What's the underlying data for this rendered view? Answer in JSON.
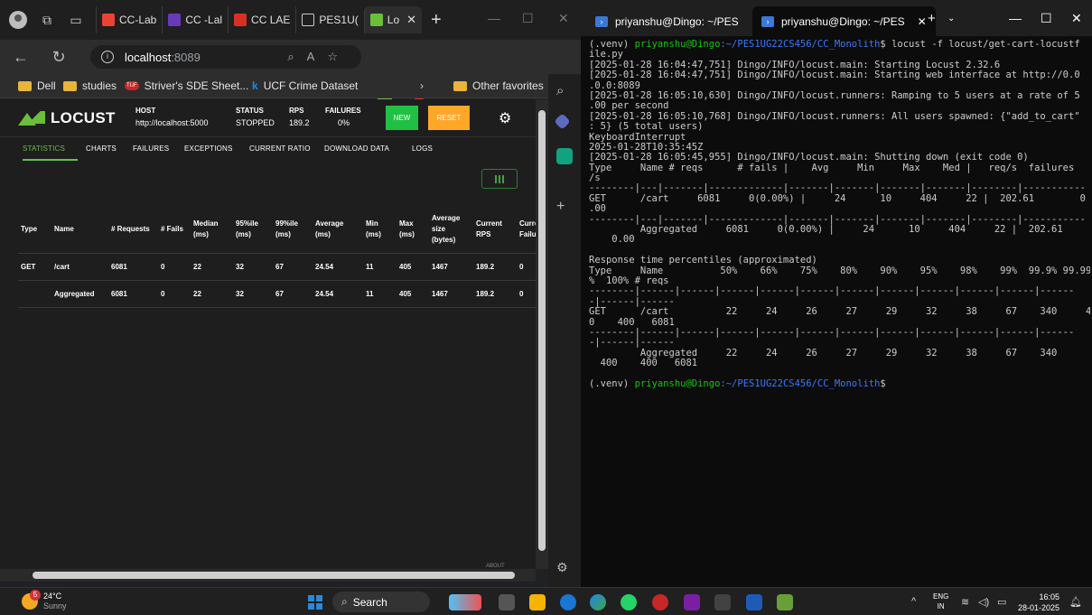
{
  "browser": {
    "tabs": [
      {
        "label": "CC-Lab",
        "icon": "gmail-icon",
        "color": "#ea4335"
      },
      {
        "label": "CC -Lal",
        "icon": "forms-icon",
        "color": "#673ab7"
      },
      {
        "label": "CC LAE",
        "icon": "docs-icon",
        "color": "#d93025"
      },
      {
        "label": "PES1U(",
        "icon": "document-icon",
        "color": "#9e9e9e"
      },
      {
        "label": "Lo",
        "icon": "locust-icon",
        "color": "#6abf3a"
      }
    ],
    "url_host": "localhost",
    "url_port": ":8089",
    "bookmarks": [
      "Dell",
      "studies",
      "Striver's SDE Sheet...",
      "UCF Crime Dataset",
      "Other favorites"
    ]
  },
  "locust": {
    "brand": "LOCUST",
    "host_label": "HOST",
    "host_value": "http://localhost:5000",
    "status_label": "STATUS",
    "status_value": "STOPPED",
    "rps_label": "RPS",
    "rps_value": "189.2",
    "failures_label": "FAILURES",
    "failures_value": "0%",
    "new_label": "NEW",
    "reset_label": "RESET",
    "tabs": [
      "STATISTICS",
      "CHARTS",
      "FAILURES",
      "EXCEPTIONS",
      "CURRENT RATIO",
      "DOWNLOAD DATA",
      "LOGS"
    ],
    "columns": [
      "Type",
      "Name",
      "# Requests",
      "# Fails",
      "Median (ms)",
      "95%ile (ms)",
      "99%ile (ms)",
      "Average (ms)",
      "Min (ms)",
      "Max (ms)",
      "Average size (bytes)",
      "Current RPS",
      "Curre Failu"
    ],
    "rows": [
      [
        "GET",
        "/cart",
        "6081",
        "0",
        "22",
        "32",
        "67",
        "24.54",
        "11",
        "405",
        "1467",
        "189.2",
        "0"
      ],
      [
        "",
        "Aggregated",
        "6081",
        "0",
        "22",
        "32",
        "67",
        "24.54",
        "11",
        "405",
        "1467",
        "189.2",
        "0"
      ]
    ],
    "about_fragment": "ABOUT"
  },
  "terminal": {
    "tabs": [
      "priyanshu@Dingo: ~/PES",
      "priyanshu@Dingo: ~/PES"
    ],
    "prompt_env": "(.venv) ",
    "prompt_user": "priyanshu@Dingo",
    "prompt_path": ":~/PES1UG22CS456/CC_Monolith",
    "command": "$ locust -f locust/get-cart-locustf",
    "lines": [
      "ile.py",
      "[2025-01-28 16:04:47,751] Dingo/INFO/locust.main: Starting Locust 2.32.6",
      "[2025-01-28 16:04:47,751] Dingo/INFO/locust.main: Starting web interface at http://0.0",
      ".0.0:8089",
      "[2025-01-28 16:05:10,630] Dingo/INFO/locust.runners: Ramping to 5 users at a rate of 5",
      ".00 per second",
      "[2025-01-28 16:05:10,768] Dingo/INFO/locust.runners: All users spawned: {\"add_to_cart\"",
      ": 5} (5 total users)",
      "KeyboardInterrupt",
      "2025-01-28T10:35:45Z",
      "[2025-01-28 16:05:45,955] Dingo/INFO/locust.main: Shutting down (exit code 0)",
      "Type     Name # reqs      # fails |    Avg     Min     Max    Med |   req/s  failures",
      "/s",
      "--------|---|-------|-------------|-------|-------|-------|-------|--------|-----------",
      "GET      /cart     6081     0(0.00%) |     24      10     404     22 |  202.61        0",
      ".00",
      "--------|---|-------|-------------|-------|-------|-------|-------|--------|-----------",
      "         Aggregated     6081     0(0.00%) |     24      10     404     22 |  202.61",
      "    0.00",
      "",
      "Response time percentiles (approximated)",
      "Type     Name          50%    66%    75%    80%    90%    95%    98%    99%  99.9% 99.99",
      "%  100% # reqs",
      "--------|------|------|------|------|------|------|------|------|------|------|------",
      "-|------|------",
      "GET      /cart          22     24     26     27     29     32     38     67    340     40",
      "0    400   6081",
      "--------|------|------|------|------|------|------|------|------|------|------|------",
      "-|------|------",
      "         Aggregated     22     24     26     27     29     32     38     67    340",
      "  400    400   6081",
      ""
    ]
  },
  "taskbar": {
    "temp": "24°C",
    "condition": "Sunny",
    "weather_badge": "5",
    "search_label": "Search",
    "lang_top": "ENG",
    "lang_bottom": "IN",
    "time": "16:05",
    "date": "28-01-2025"
  }
}
